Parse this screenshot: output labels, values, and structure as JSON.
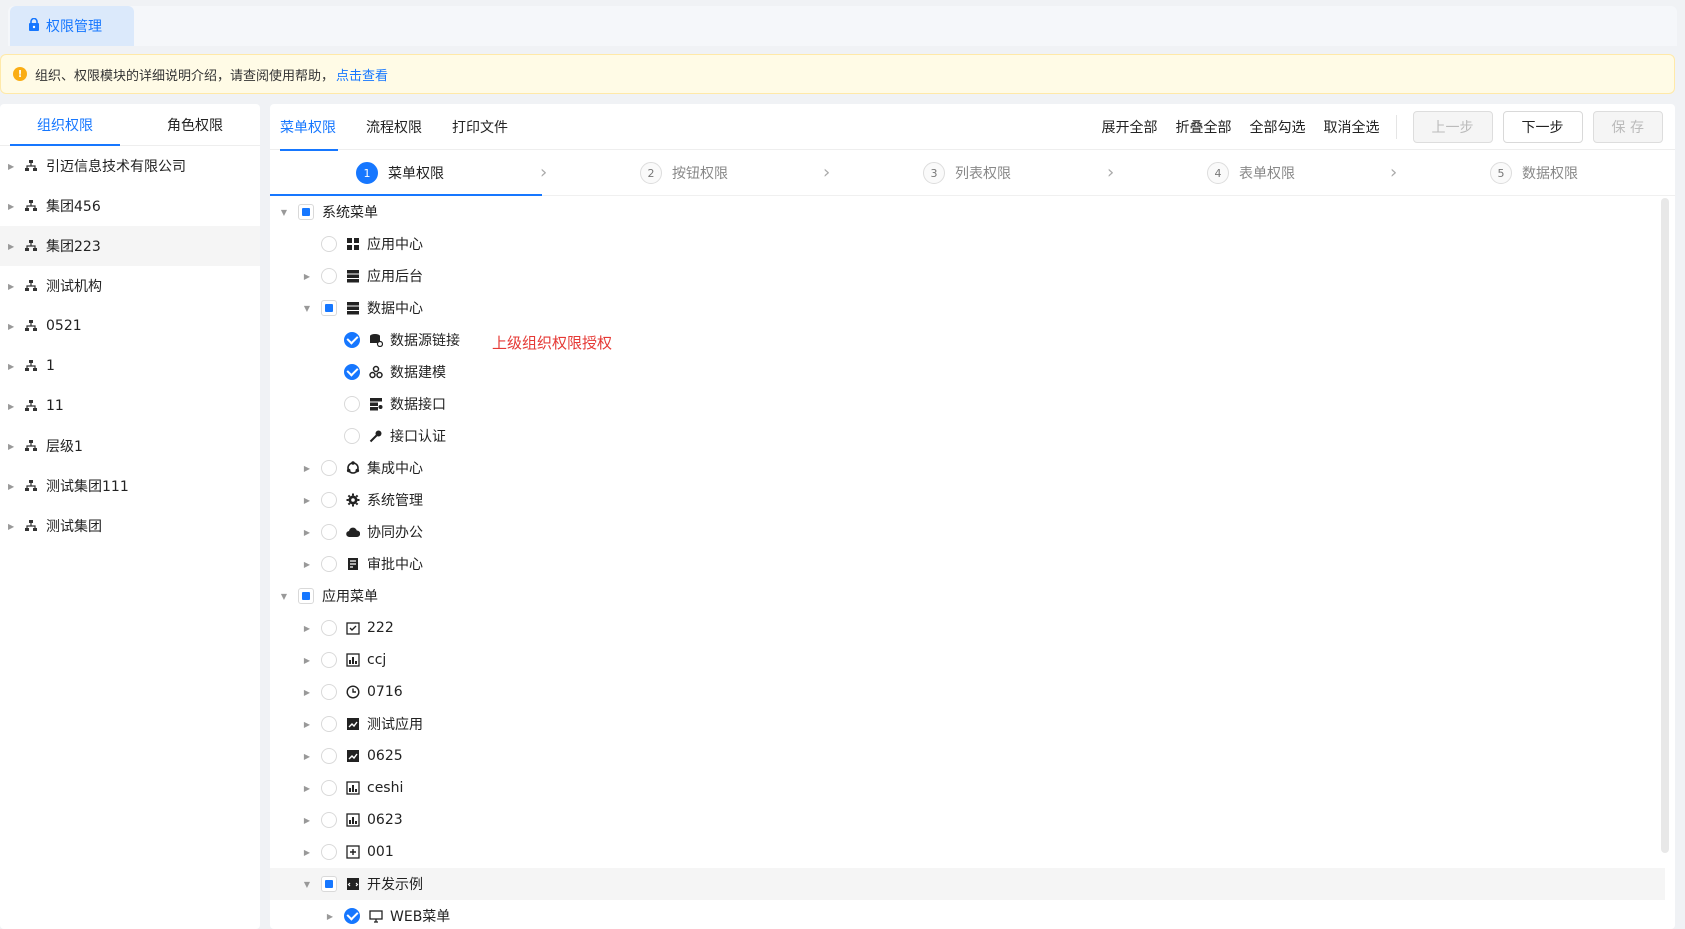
{
  "top_tab": {
    "label": "权限管理"
  },
  "notice": {
    "text": "组织、权限模块的详细说明介绍，请查阅使用帮助，",
    "link": "点击查看"
  },
  "left": {
    "tabs": [
      "组织权限",
      "角色权限"
    ],
    "orgs": [
      "引迈信息技术有限公司",
      "集团456",
      "集团223",
      "测试机构",
      "0521",
      "1",
      "11",
      "层级1",
      "测试集团111",
      "测试集团"
    ]
  },
  "right": {
    "tabs": [
      "菜单权限",
      "流程权限",
      "打印文件"
    ],
    "actions": [
      "展开全部",
      "折叠全部",
      "全部勾选",
      "取消全选"
    ],
    "buttons": {
      "prev": "上一步",
      "next": "下一步",
      "save": "保 存"
    },
    "steps": [
      {
        "num": "1",
        "label": "菜单权限"
      },
      {
        "num": "2",
        "label": "按钮权限"
      },
      {
        "num": "3",
        "label": "列表权限"
      },
      {
        "num": "4",
        "label": "表单权限"
      },
      {
        "num": "5",
        "label": "数据权限"
      }
    ],
    "note": "上级组织权限授权",
    "tree": {
      "sys": "系统菜单",
      "app_center": "应用中心",
      "app_backend": "应用后台",
      "data_center": "数据中心",
      "ds_link": "数据源链接",
      "data_model": "数据建模",
      "data_api": "数据接口",
      "api_auth": "接口认证",
      "integration": "集成中心",
      "sys_manage": "系统管理",
      "office": "协同办公",
      "approval": "审批中心",
      "app_menu": "应用菜单",
      "m222": "222",
      "ccj": "ccj",
      "m0716": "0716",
      "test_app": "测试应用",
      "m0625": "0625",
      "ceshi": "ceshi",
      "m0623": "0623",
      "m001": "001",
      "dev_sample": "开发示例",
      "web_menu": "WEB菜单"
    }
  }
}
